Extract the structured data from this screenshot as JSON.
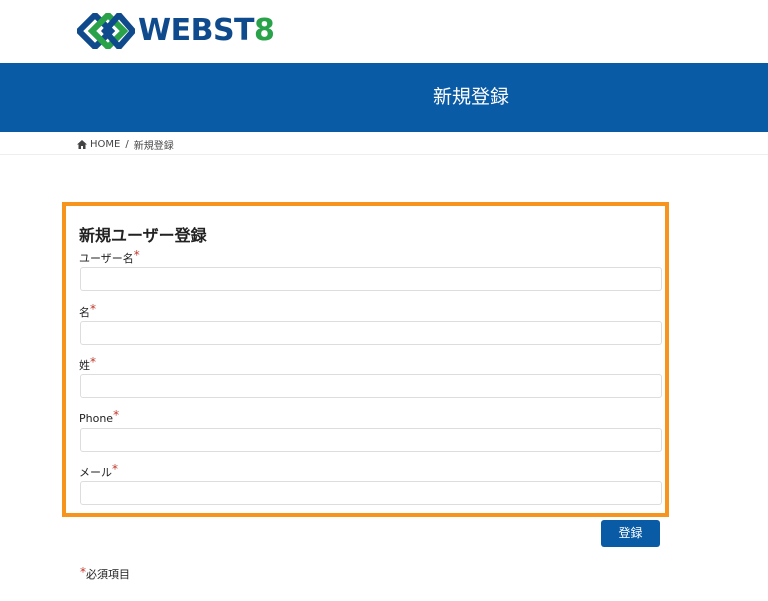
{
  "header": {
    "logo_text_main": "WEBST",
    "logo_text_accent": "8"
  },
  "banner": {
    "title": "新規登録"
  },
  "breadcrumb": {
    "home": "HOME",
    "separator": "/",
    "current": "新規登録"
  },
  "form": {
    "title": "新規ユーザー登録",
    "required_mark": "*",
    "fields": [
      {
        "label": "ユーザー名",
        "value": ""
      },
      {
        "label": "名",
        "value": ""
      },
      {
        "label": "姓",
        "value": ""
      },
      {
        "label": "Phone",
        "value": ""
      },
      {
        "label": "メール",
        "value": ""
      }
    ],
    "submit_label": "登録",
    "required_note": "必須項目"
  },
  "colors": {
    "brand_blue": "#0a5ba6",
    "logo_blue": "#0f4b8c",
    "logo_green": "#2aa24a",
    "highlight_orange": "#f7941e",
    "required_red": "#c0392b"
  }
}
